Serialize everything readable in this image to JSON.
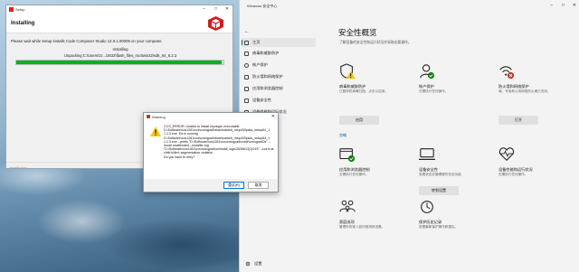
{
  "setup": {
    "window_title": "Setup",
    "heading": "Installing",
    "message": "Please wait while Setup installs Code Composer Studio 12.8.1.00005 on your computer.",
    "status": "Installing",
    "detail": "Unpacking C:\\Users\\zz...\\2632\\flash_files_root\\win32\\sdk_64_8.2.3",
    "progress": 0.99,
    "brand": "InstallBuilder",
    "accent": "#06b025"
  },
  "warning": {
    "window_title": "Warning",
    "lines": [
      "CCS_ERROR: Unable to install repotype executable",
      "D:\\Software\\ccs1281\\ccs\\ccs\\qpad\\downloads\\ti_msp430pack_setup64_1",
      "1.1.0.exe. Error running",
      "D:\\Software\\ccs1281\\ccs\\ccs\\qpad\\downloads\\ti_msp430pack_setup64_1",
      "1.1.0.exe --prefix \"D:\\Software\\ccs1281\\ccs\\ccs\\qpad\\ccs\\ti\\ccs\\qpadOs\" --mode unattended --installer-log",
      "\"D:\\Software\\ccs1281\\ccs\\ccs\\qpad\\uninstall_logs\\2636613(1)019\" --ccs true",
      "child killed: segmentation violation",
      "Do you want to retry?"
    ],
    "yes_label": "重试(R)",
    "no_label": "取消"
  },
  "security": {
    "window_title": "Windows 安全中心",
    "back_glyph": "←",
    "menu_glyph": "≡",
    "nav": [
      {
        "label": "主页",
        "icon": "home-icon"
      },
      {
        "label": "病毒和威胁防护",
        "icon": "shield-icon"
      },
      {
        "label": "帐户保护",
        "icon": "person-icon"
      },
      {
        "label": "防火墙和网络保护",
        "icon": "wifi-icon"
      },
      {
        "label": "应用和浏览器控制",
        "icon": "window-icon"
      },
      {
        "label": "设备安全性",
        "icon": "laptop-icon"
      },
      {
        "label": "设备性能和运行状况",
        "icon": "heart-icon"
      },
      {
        "label": "家庭选项",
        "icon": "family-icon"
      }
    ],
    "settings_label": "设置",
    "title": "安全性概览",
    "subtitle": "了解设备的安全性和运行状况并采取必要操作。",
    "cards": [
      {
        "title": "病毒和威胁防护",
        "desc": "已暂停防病毒扫描。点击以启用。",
        "button": "启用",
        "link": "忽略",
        "icon": "virus-shield-warning-icon"
      },
      {
        "title": "帐户保护",
        "desc": "无需执行任何操作。",
        "button": "",
        "link": "",
        "icon": "account-ok-icon"
      },
      {
        "title": "防火墙和网络保护",
        "desc": "域、专用和公用网络防火墙已关闭。",
        "button": "打开",
        "link": "",
        "icon": "firewall-error-icon"
      },
      {
        "title": "应用和浏览器控制",
        "desc": "无需执行任何操作。",
        "button": "",
        "link": "",
        "icon": "browser-ok-icon"
      },
      {
        "title": "设备安全性",
        "desc": "查看状态并管理硬件安全功能",
        "button": "转到设置",
        "link": "",
        "icon": "device-security-icon"
      },
      {
        "title": "设备性能和运行状况",
        "desc": "无需执行任何操作。",
        "button": "",
        "link": "",
        "icon": "health-icon"
      },
      {
        "title": "家庭选项",
        "desc": "管理你的家人如何使用其设备。",
        "button": "",
        "link": "",
        "icon": "family-icon"
      },
      {
        "title": "保护历史记录",
        "desc": "查看最新保护操作和建议。",
        "button": "",
        "link": "",
        "icon": "history-icon"
      }
    ]
  }
}
